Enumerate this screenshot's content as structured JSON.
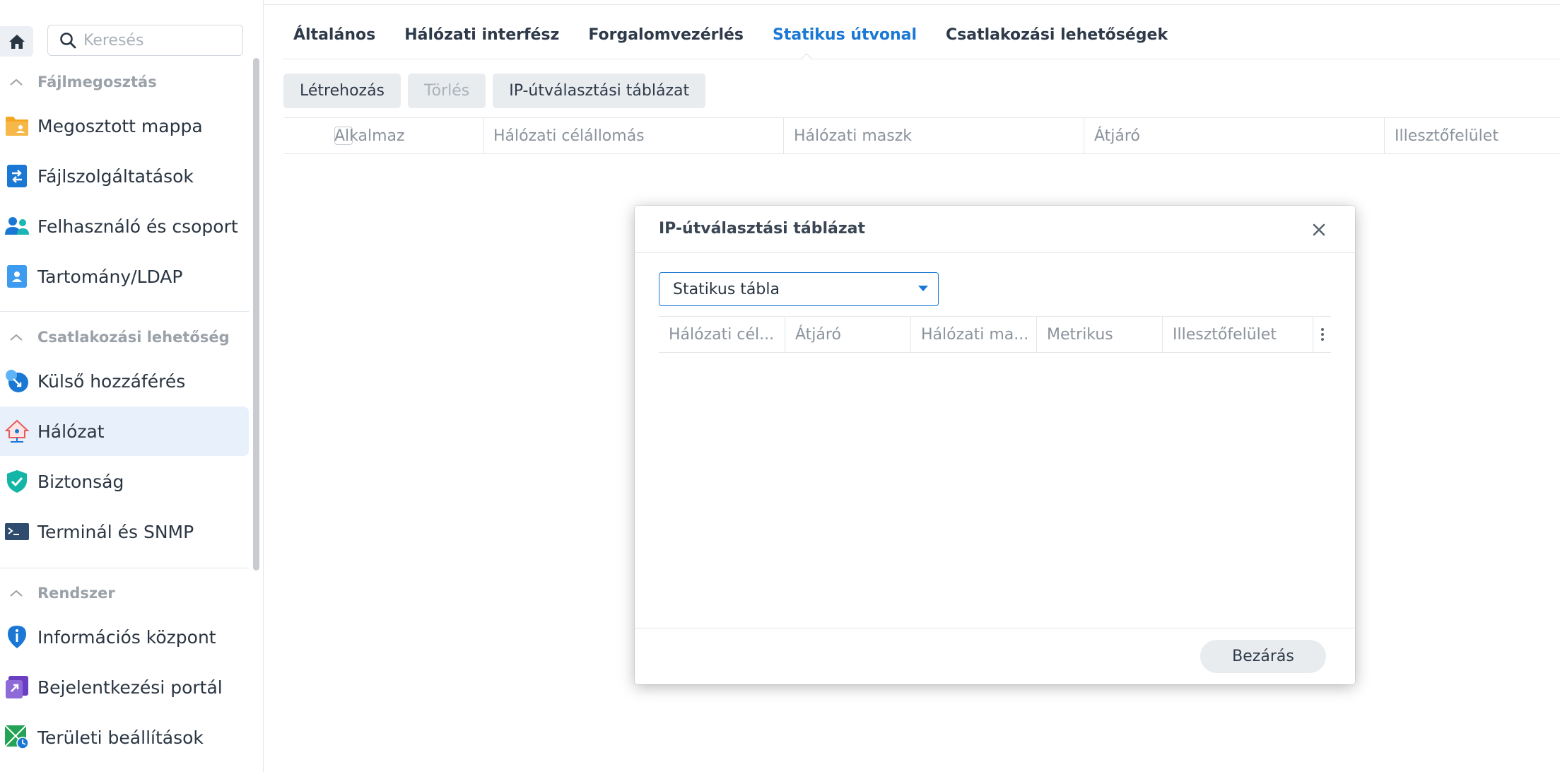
{
  "sidebar": {
    "search_placeholder": "Keresés",
    "sections": [
      {
        "title": "Fájlmegosztás"
      },
      {
        "title": "Csatlakozási lehetőség"
      },
      {
        "title": "Rendszer"
      }
    ],
    "items": [
      {
        "label": "Megosztott mappa",
        "icon": "shared-folder-icon"
      },
      {
        "label": "Fájlszolgáltatások",
        "icon": "file-services-icon"
      },
      {
        "label": "Felhasználó és csoport",
        "icon": "user-group-icon"
      },
      {
        "label": "Tartomány/LDAP",
        "icon": "domain-ldap-icon"
      },
      {
        "label": "Külső hozzáférés",
        "icon": "external-access-icon"
      },
      {
        "label": "Hálózat",
        "icon": "network-icon",
        "active": true
      },
      {
        "label": "Biztonság",
        "icon": "security-shield-icon"
      },
      {
        "label": "Terminál és SNMP",
        "icon": "terminal-icon"
      },
      {
        "label": "Információs központ",
        "icon": "info-center-icon"
      },
      {
        "label": "Bejelentkezési portál",
        "icon": "login-portal-icon"
      },
      {
        "label": "Területi beállítások",
        "icon": "regional-options-icon"
      }
    ]
  },
  "tabs": [
    {
      "label": "Általános"
    },
    {
      "label": "Hálózati interfész"
    },
    {
      "label": "Forgalomvezérlés"
    },
    {
      "label": "Statikus útvonal",
      "active": true
    },
    {
      "label": "Csatlakozási lehetőségek"
    }
  ],
  "toolbar": {
    "create": "Létrehozás",
    "delete": "Törlés",
    "routing_table": "IP-útválasztási táblázat"
  },
  "grid": {
    "columns": [
      "Alkalmaz",
      "Hálózati célállomás",
      "Hálózati maszk",
      "Átjáró",
      "Illesztőfelület"
    ]
  },
  "dialog": {
    "title": "IP-útválasztási táblázat",
    "dropdown_value": "Statikus tábla",
    "columns": [
      "Hálózati cél...",
      "Átjáró",
      "Hálózati ma...",
      "Metrikus",
      "Illesztőfelület"
    ],
    "close_label": "Bezárás"
  },
  "colors": {
    "accent": "#1a78d4",
    "active_bg": "#e8f0fb"
  }
}
